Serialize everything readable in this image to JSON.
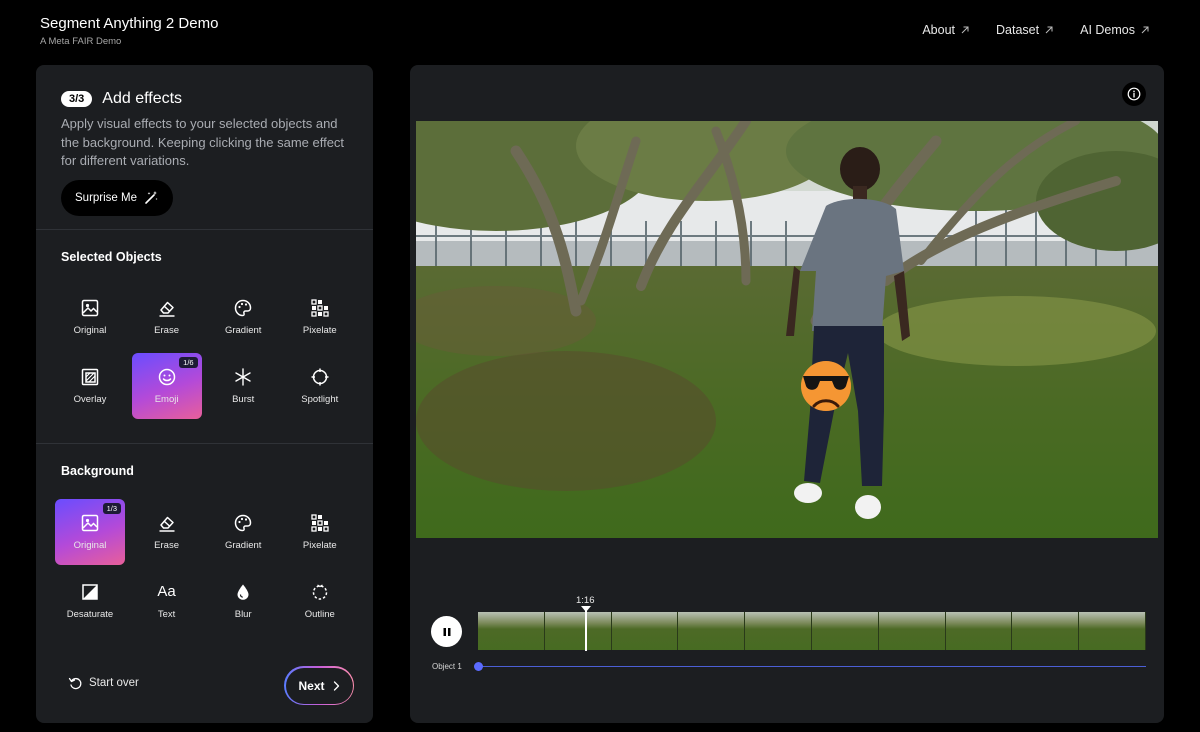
{
  "header": {
    "title": "Segment Anything 2 Demo",
    "subtitle": "A Meta FAIR Demo",
    "nav": [
      {
        "label": "About"
      },
      {
        "label": "Dataset"
      },
      {
        "label": "AI Demos"
      }
    ]
  },
  "panel": {
    "step_badge": "3/3",
    "step_title": "Add effects",
    "description": "Apply visual effects to your selected objects and the background. Keeping clicking the same effect for different variations.",
    "surprise_label": "Surprise Me",
    "selected_objects": {
      "title": "Selected Objects",
      "effects": [
        {
          "label": "Original",
          "icon": "image-icon"
        },
        {
          "label": "Erase",
          "icon": "eraser-icon"
        },
        {
          "label": "Gradient",
          "icon": "palette-icon"
        },
        {
          "label": "Pixelate",
          "icon": "pixelate-icon"
        },
        {
          "label": "Overlay",
          "icon": "overlay-icon"
        },
        {
          "label": "Emoji",
          "icon": "smiley-icon",
          "selected": true,
          "badge": "1/6"
        },
        {
          "label": "Burst",
          "icon": "burst-icon"
        },
        {
          "label": "Spotlight",
          "icon": "spotlight-icon"
        }
      ]
    },
    "background": {
      "title": "Background",
      "effects": [
        {
          "label": "Original",
          "icon": "image-icon",
          "selected": true,
          "badge": "1/3"
        },
        {
          "label": "Erase",
          "icon": "eraser-icon"
        },
        {
          "label": "Gradient",
          "icon": "palette-icon"
        },
        {
          "label": "Pixelate",
          "icon": "pixelate-icon"
        },
        {
          "label": "Desaturate",
          "icon": "desaturate-icon"
        },
        {
          "label": "Text",
          "icon": "text-icon",
          "glyph": "Aa"
        },
        {
          "label": "Blur",
          "icon": "drop-icon"
        },
        {
          "label": "Outline",
          "icon": "outline-icon"
        }
      ]
    },
    "start_over_label": "Start over",
    "next_label": "Next"
  },
  "player": {
    "timecode": "1:16",
    "track_label": "Object 1",
    "accent_color": "#5b6bff"
  }
}
